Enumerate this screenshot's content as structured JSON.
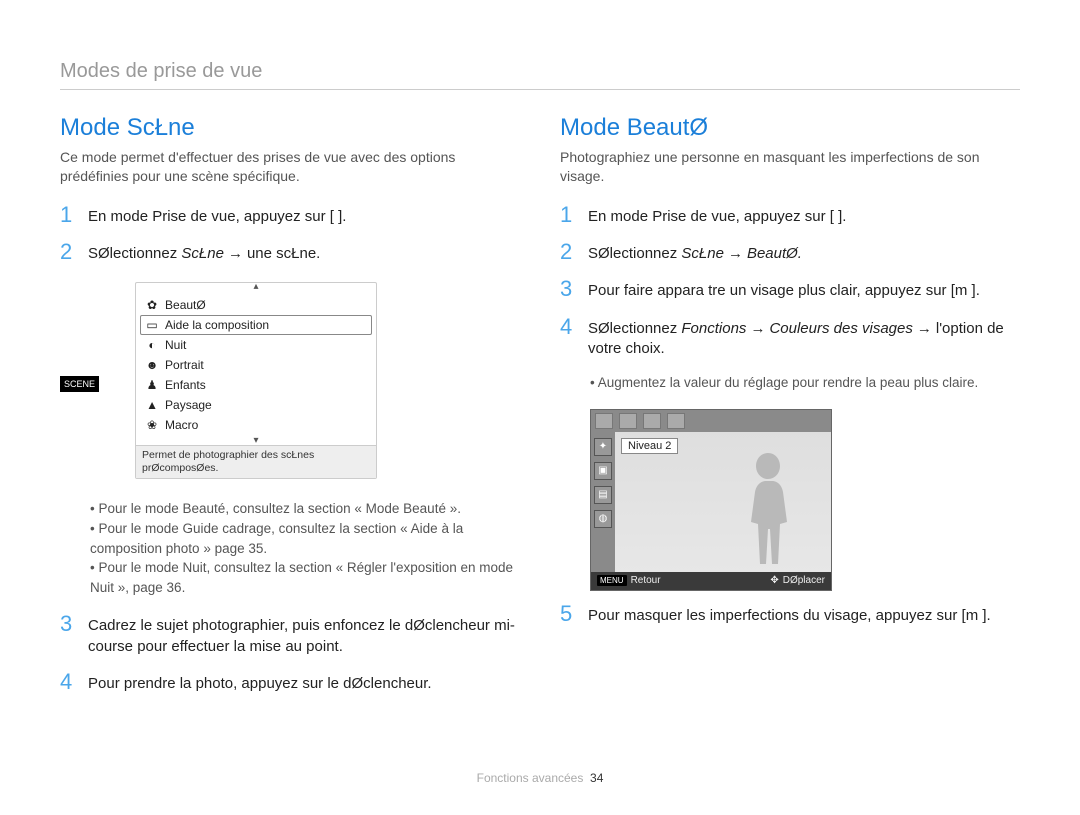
{
  "section_header": "Modes de prise de vue",
  "footer_label": "Fonctions avancées",
  "footer_page": "34",
  "left": {
    "title": "Mode ScŁne",
    "intro": "Ce mode permet d'effectuer des prises de vue avec des options prédéfinies pour une scène spécifique.",
    "step1": "En mode Prise de vue, appuyez sur [     ].",
    "step2_a": "SØlectionnez ",
    "step2_b": "ScŁne",
    "step2_arrow": "→",
    "step2_c": "une scŁne.",
    "menu": {
      "items": [
        {
          "icon": "✿",
          "label": "BeautØ"
        },
        {
          "icon": "▭",
          "label": "Aide   la composition"
        },
        {
          "icon": "◐",
          "label": "Nuit"
        },
        {
          "icon": "☻",
          "label": "Portrait"
        },
        {
          "icon": "♟",
          "label": "Enfants"
        },
        {
          "icon": "▲",
          "label": "Paysage"
        },
        {
          "icon": "❀",
          "label": "Macro"
        }
      ],
      "selected_index": 1,
      "side_label": "SCENE",
      "hint": "Permet de photographier des scŁnes prØcomposØes."
    },
    "bullets": [
      "Pour le mode Beauté, consultez la section « Mode Beauté ».",
      "Pour le mode Guide cadrage, consultez la section « Aide à la composition photo » page 35.",
      "Pour le mode Nuit, consultez la section « Régler l'exposition en mode Nuit », page 36."
    ],
    "step3": "Cadrez le sujet   photographier, puis enfoncez le dØclencheur   mi-course pour effectuer la mise au point.",
    "step4": "Pour prendre la photo, appuyez sur le dØclencheur."
  },
  "right": {
    "title": "Mode BeautØ",
    "intro": "Photographiez une personne en masquant les imperfections de son visage.",
    "step1": "En mode Prise de vue, appuyez sur [     ].",
    "step2_a": "SØlectionnez ",
    "step2_b": "ScŁne",
    "step2_arrow": "→",
    "step2_c": "BeautØ.",
    "step3": "Pour faire appara tre un visage plus clair, appuyez sur [m       ].",
    "step4_a": "SØlectionnez ",
    "step4_b": "Fonctions",
    "step4_arrow1": "→",
    "step4_c": "Couleurs des visages",
    "step4_arrow2": "→",
    "step4_d": "l'option de votre choix.",
    "bullet": "Augmentez la valeur du réglage pour rendre la peau plus claire.",
    "ui": {
      "level_label": "Niveau 2",
      "menu_label": "MENU",
      "back_label": "Retour",
      "move_label": "DØplacer"
    },
    "step5": "Pour masquer les imperfections du visage, appuyez sur [m       ]."
  }
}
